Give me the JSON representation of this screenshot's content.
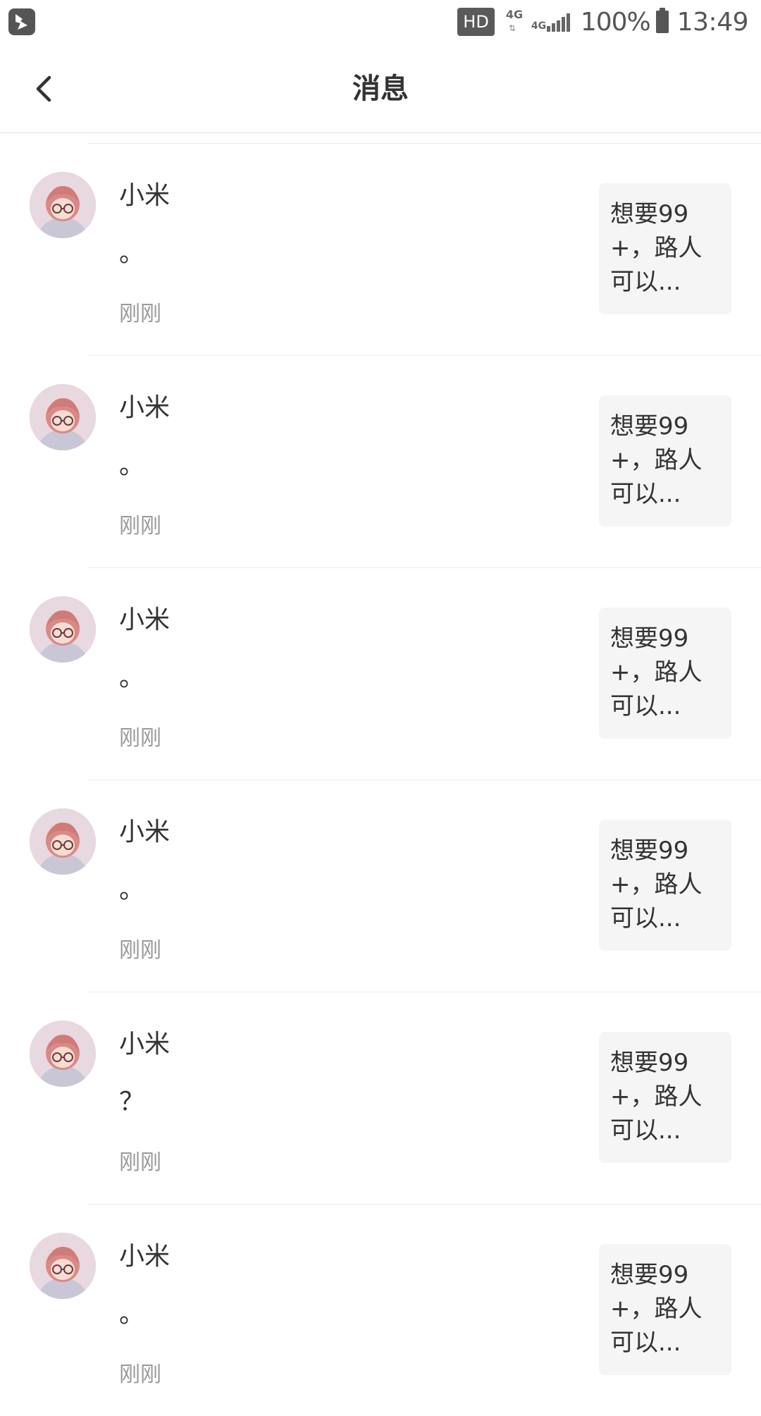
{
  "status_bar": {
    "hd": "HD",
    "net1": "4G",
    "net2": "4G",
    "battery": "100%",
    "time": "13:49"
  },
  "header": {
    "title": "消息"
  },
  "messages": [
    {
      "name": "小米",
      "text": "。",
      "time": "刚刚",
      "preview": "想要99+，路人可以..."
    },
    {
      "name": "小米",
      "text": "。",
      "time": "刚刚",
      "preview": "想要99+，路人可以..."
    },
    {
      "name": "小米",
      "text": "。",
      "time": "刚刚",
      "preview": "想要99+，路人可以..."
    },
    {
      "name": "小米",
      "text": "。",
      "time": "刚刚",
      "preview": "想要99+，路人可以..."
    },
    {
      "name": "小米",
      "text": "？",
      "time": "刚刚",
      "preview": "想要99+，路人可以..."
    },
    {
      "name": "小米",
      "text": "。",
      "time": "刚刚",
      "preview": "想要99+，路人可以..."
    }
  ]
}
